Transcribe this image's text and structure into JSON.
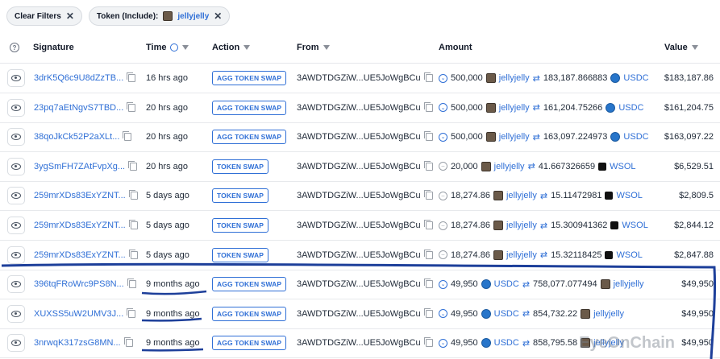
{
  "filters": {
    "clear_label": "Clear Filters",
    "token_label": "Token (Include):",
    "token_value": "jellyjelly"
  },
  "columns": {
    "signature": "Signature",
    "time": "Time",
    "action": "Action",
    "from": "From",
    "amount": "Amount",
    "value": "Value"
  },
  "rows": [
    {
      "sig": "3drK5Q6c9U8dZzTB...",
      "time": "16 hrs ago",
      "action": "AGG TOKEN SWAP",
      "from": "3AWDTDGZiW...UE5JoWgBCu",
      "in_amt": "500,000",
      "in_tok": "jellyjelly",
      "out_amt": "183,187.866883",
      "out_tok": "USDC",
      "value": "$183,187.86"
    },
    {
      "sig": "23pq7aEtNgvS7TBD...",
      "time": "20 hrs ago",
      "action": "AGG TOKEN SWAP",
      "from": "3AWDTDGZiW...UE5JoWgBCu",
      "in_amt": "500,000",
      "in_tok": "jellyjelly",
      "out_amt": "161,204.75266",
      "out_tok": "USDC",
      "value": "$161,204.75"
    },
    {
      "sig": "38qoJkCk52P2aXLt...",
      "time": "20 hrs ago",
      "action": "AGG TOKEN SWAP",
      "from": "3AWDTDGZiW...UE5JoWgBCu",
      "in_amt": "500,000",
      "in_tok": "jellyjelly",
      "out_amt": "163,097.224973",
      "out_tok": "USDC",
      "value": "$163,097.22"
    },
    {
      "sig": "3ygSmFH7ZAtFvpXg...",
      "time": "20 hrs ago",
      "action": "TOKEN SWAP",
      "from": "3AWDTDGZiW...UE5JoWgBCu",
      "in_amt": "20,000",
      "in_tok": "jellyjelly",
      "out_amt": "41.667326659",
      "out_tok": "WSOL",
      "value": "$6,529.51"
    },
    {
      "sig": "259mrXDs83ExYZNT...",
      "time": "5 days ago",
      "action": "TOKEN SWAP",
      "from": "3AWDTDGZiW...UE5JoWgBCu",
      "in_amt": "18,274.86",
      "in_tok": "jellyjelly",
      "out_amt": "15.11472981",
      "out_tok": "WSOL",
      "value": "$2,809.5"
    },
    {
      "sig": "259mrXDs83ExYZNT...",
      "time": "5 days ago",
      "action": "TOKEN SWAP",
      "from": "3AWDTDGZiW...UE5JoWgBCu",
      "in_amt": "18,274.86",
      "in_tok": "jellyjelly",
      "out_amt": "15.300941362",
      "out_tok": "WSOL",
      "value": "$2,844.12"
    },
    {
      "sig": "259mrXDs83ExYZNT...",
      "time": "5 days ago",
      "action": "TOKEN SWAP",
      "from": "3AWDTDGZiW...UE5JoWgBCu",
      "in_amt": "18,274.86",
      "in_tok": "jellyjelly",
      "out_amt": "15.32118425",
      "out_tok": "WSOL",
      "value": "$2,847.88"
    },
    {
      "sig": "396tqFRoWrc9PS8N...",
      "time": "9 months ago",
      "action": "AGG TOKEN SWAP",
      "from": "3AWDTDGZiW...UE5JoWgBCu",
      "in_amt": "49,950",
      "in_tok": "USDC",
      "out_amt": "758,077.077494",
      "out_tok": "jellyjelly",
      "value": "$49,950"
    },
    {
      "sig": "XUXSS5uW2UMV3J...",
      "time": "9 months ago",
      "action": "AGG TOKEN SWAP",
      "from": "3AWDTDGZiW...UE5JoWgBCu",
      "in_amt": "49,950",
      "in_tok": "USDC",
      "out_amt": "854,732.22",
      "out_tok": "jellyjelly",
      "value": "$49,950"
    },
    {
      "sig": "3nrwqK317zsG8MN...",
      "time": "9 months ago",
      "action": "AGG TOKEN SWAP",
      "from": "3AWDTDGZiW...UE5JoWgBCu",
      "in_amt": "49,950",
      "in_tok": "USDC",
      "out_amt": "858,795.58",
      "out_tok": "jellyjelly",
      "value": "$49,950"
    }
  ],
  "watermark": "EyeOnChain",
  "colors": {
    "link": "#2f6fd6",
    "annotation": "#1d3f9a",
    "usdc": "#2775ca",
    "wsol": "#111111"
  }
}
